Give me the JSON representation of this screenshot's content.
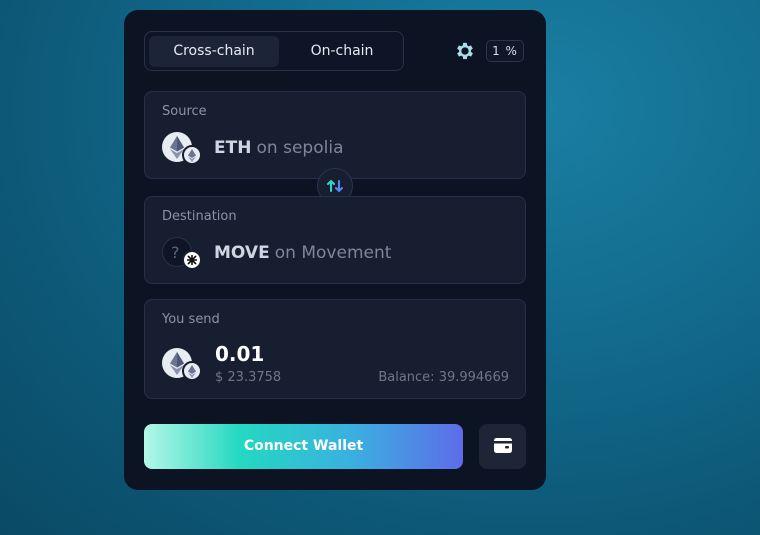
{
  "tabs": [
    {
      "label": "Cross-chain",
      "active": true
    },
    {
      "label": "On-chain",
      "active": false
    }
  ],
  "settings": {
    "icon": "gear-icon",
    "slippage": "1 %"
  },
  "source": {
    "label": "Source",
    "asset": "ETH",
    "network": "on sepolia",
    "icon": "ethereum-icon"
  },
  "destination": {
    "label": "Destination",
    "asset": "MOVE",
    "network": "on Movement",
    "icon": "unknown-token-icon"
  },
  "send": {
    "label": "You send",
    "amount": "0.01",
    "usd": "$ 23.3758",
    "balance": "Balance: 39.994669"
  },
  "actions": {
    "connect_label": "Connect Wallet",
    "wallet_icon": "wallet-icon"
  },
  "colors": {
    "card_bg": "#0c1323",
    "panel_bg": "#171e2f",
    "accent_gradient_start": "#b3f7e7",
    "accent_gradient_end": "#5e6ce9"
  }
}
